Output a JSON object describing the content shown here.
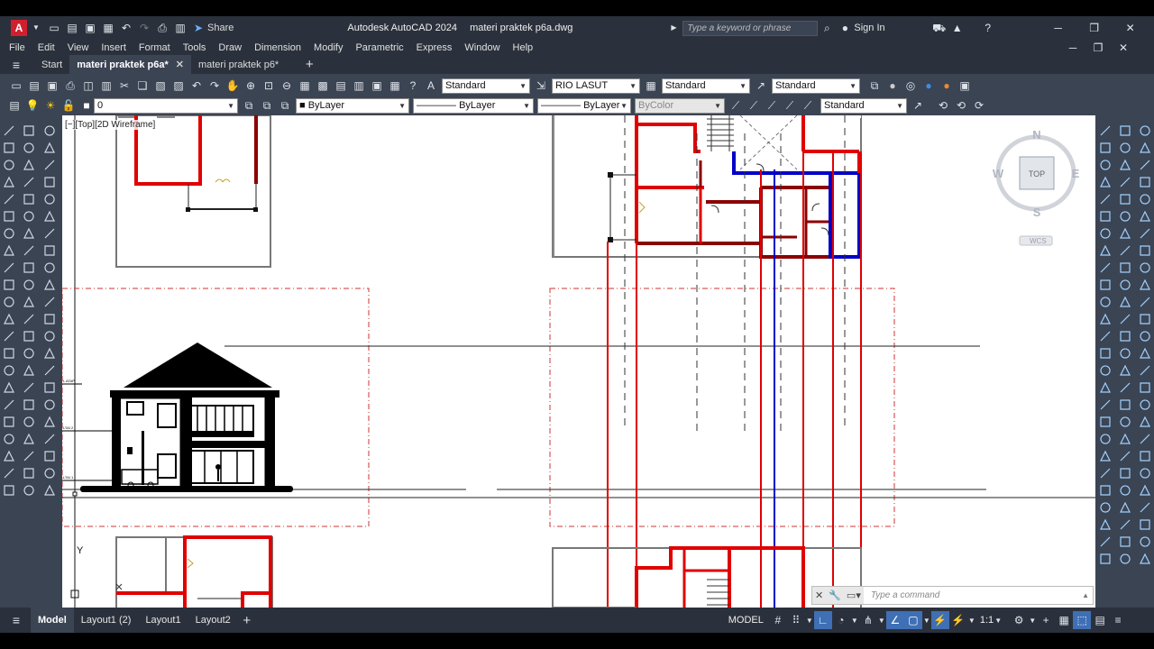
{
  "title": {
    "app": "Autodesk AutoCAD 2024",
    "file": "materi praktek p6a.dwg",
    "share": "Share",
    "search_placeholder": "Type a keyword or phrase",
    "sign_in": "Sign In"
  },
  "menu": [
    "File",
    "Edit",
    "View",
    "Insert",
    "Format",
    "Tools",
    "Draw",
    "Dimension",
    "Modify",
    "Parametric",
    "Express",
    "Window",
    "Help"
  ],
  "tabs": {
    "start": "Start",
    "doc1": "materi praktek p6a*",
    "doc2": "materi praktek p6*"
  },
  "styles": {
    "text_style": "Standard",
    "dim_style": "RIO LASUT",
    "table_style": "Standard",
    "mleader_style": "Standard",
    "layer": "0",
    "color": "ByLayer",
    "linetype": "ByLayer",
    "lineweight": "ByLayer",
    "plotstyle": "ByColor",
    "visual_style": "Standard"
  },
  "viewport": {
    "label": "[−][Top][2D Wireframe]",
    "cube_top": "TOP",
    "north": "N",
    "south": "S",
    "east": "E",
    "west": "W",
    "ucs": "WCS",
    "axis_y": "Y"
  },
  "elevation_labels": {
    "level1": "L ATAP",
    "level2": "LTAI 2",
    "level3": "LTAI 1"
  },
  "command": {
    "placeholder": "Type a command"
  },
  "layout_tabs": {
    "model": "Model",
    "l1": "Layout1 (2)",
    "l2": "Layout1",
    "l3": "Layout2"
  },
  "status": {
    "mode": "MODEL",
    "scale": "1:1"
  },
  "colors": {
    "red_wall": "#e00000",
    "dark_red": "#8b0000",
    "blue": "#0000c8",
    "dash_red": "#cc3333"
  }
}
